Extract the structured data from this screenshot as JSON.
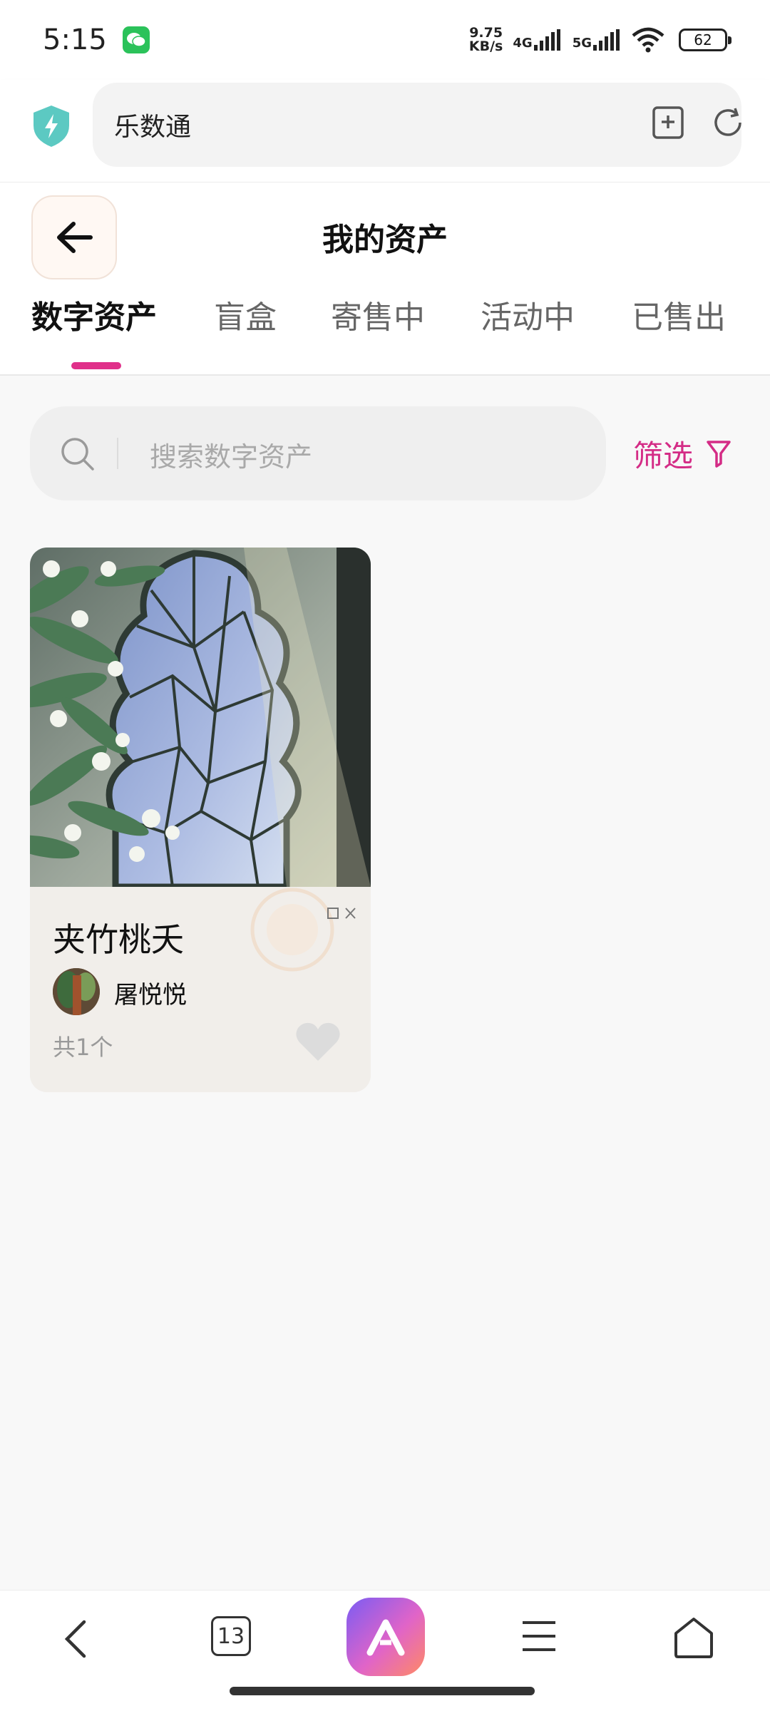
{
  "status_bar": {
    "time": "5:15",
    "net_speed_value": "9.75",
    "net_speed_unit": "KB/s",
    "signal_1": "4G",
    "signal_2": "5G",
    "battery": "62"
  },
  "browser": {
    "url_text": "乐数通"
  },
  "header": {
    "title": "我的资产",
    "tabs": [
      {
        "label": "数字资产",
        "active": true
      },
      {
        "label": "盲盒",
        "active": false
      },
      {
        "label": "寄售中",
        "active": false
      },
      {
        "label": "活动中",
        "active": false
      },
      {
        "label": "已售出",
        "active": false
      }
    ]
  },
  "search": {
    "placeholder": "搜索数字资产",
    "filter_label": "筛选"
  },
  "assets": [
    {
      "title": "夹竹桃夭",
      "creator": "屠悦悦",
      "count": "共1个"
    }
  ],
  "bottom_nav": {
    "tab_count": "13"
  },
  "colors": {
    "accent": "#e0308a",
    "filter": "#d42c86",
    "wechat": "#2bc25a"
  }
}
